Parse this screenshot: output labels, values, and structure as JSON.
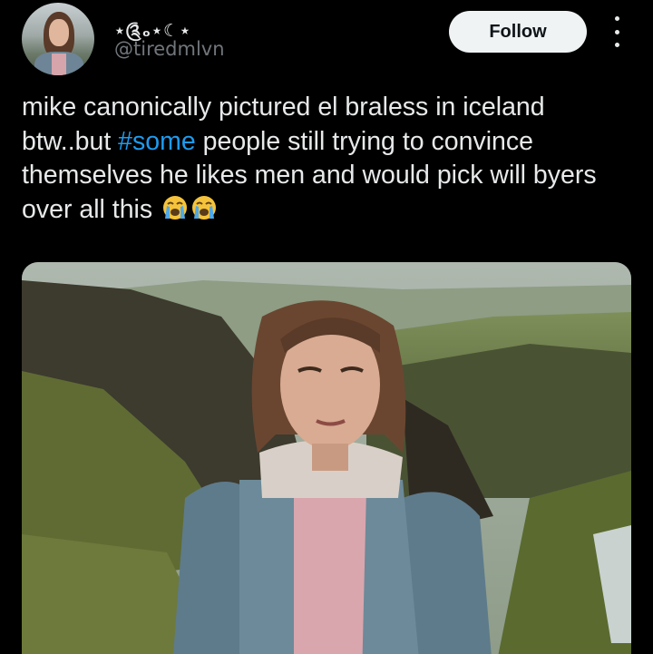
{
  "author": {
    "display_name": "⋆༊ₒ⋆☾⋆",
    "handle": "@tiredmlvn"
  },
  "actions": {
    "follow_label": "Follow",
    "more_icon": "more-vertical-icon"
  },
  "tweet": {
    "text_before": "mike canonically pictured el braless in iceland btw..but ",
    "hashtag": "#some",
    "text_after": " people still trying to convince themselves he likes men and would pick will byers over all this",
    "emoji_icons": [
      "loudly-crying-face-icon",
      "loudly-crying-face-icon"
    ]
  },
  "colors": {
    "background": "#000000",
    "text": "#e7e9ea",
    "muted": "#71767b",
    "link": "#1d9bf0",
    "follow_bg": "#eff3f4",
    "emoji": "#f5c33b"
  }
}
